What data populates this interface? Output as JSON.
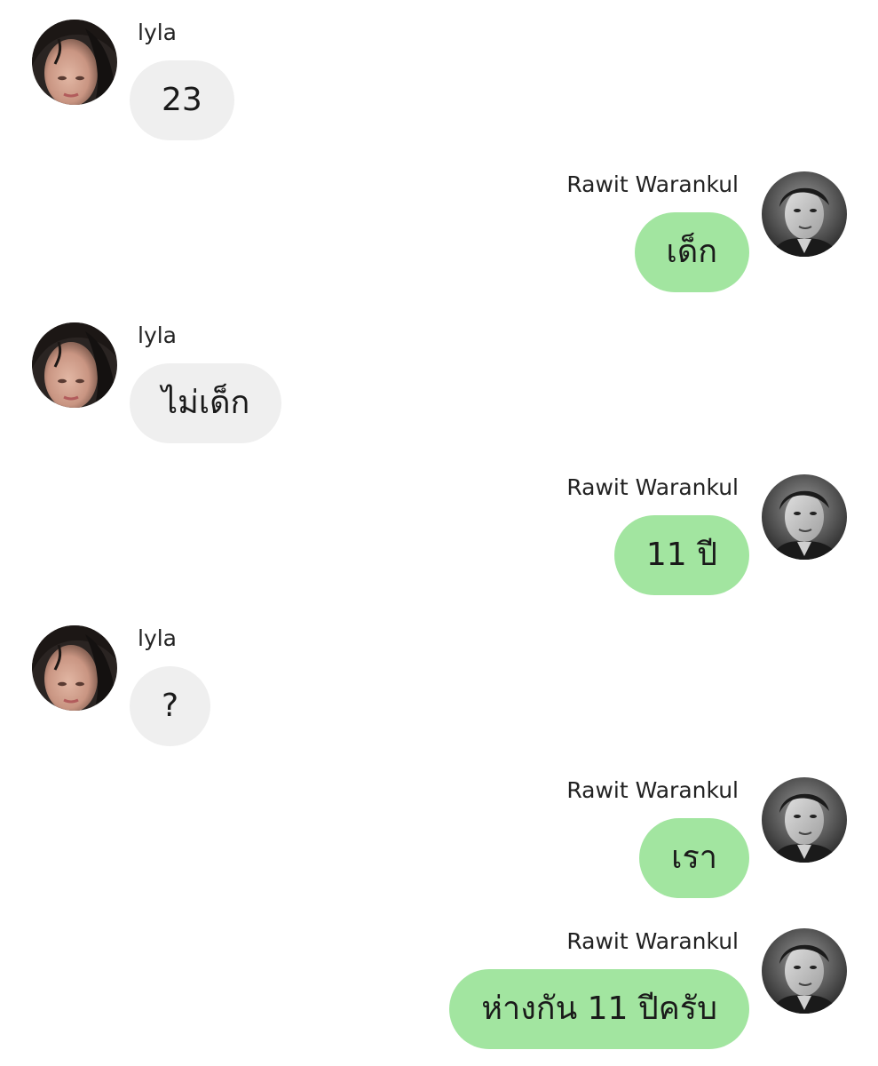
{
  "chat": {
    "messages": [
      {
        "side": "left",
        "sender": "lyla",
        "text": "23",
        "avatar": "lyla-avatar"
      },
      {
        "side": "right",
        "sender": "Rawit Warankul",
        "text": "เด็ก",
        "avatar": "rawit-avatar"
      },
      {
        "side": "left",
        "sender": "lyla",
        "text": "ไม่เด็ก",
        "avatar": "lyla-avatar"
      },
      {
        "side": "right",
        "sender": "Rawit Warankul",
        "text": "11 ปี",
        "avatar": "rawit-avatar"
      },
      {
        "side": "left",
        "sender": "lyla",
        "text": "?",
        "avatar": "lyla-avatar"
      },
      {
        "side": "right",
        "sender": "Rawit Warankul",
        "text": "เรา",
        "avatar": "rawit-avatar"
      },
      {
        "side": "right",
        "sender": "Rawit Warankul",
        "text": "ห่างกัน 11 ปีครับ",
        "avatar": "rawit-avatar"
      }
    ]
  },
  "colors": {
    "incoming_bubble": "#efefef",
    "outgoing_bubble": "#a2e5a0",
    "background": "#ffffff"
  }
}
